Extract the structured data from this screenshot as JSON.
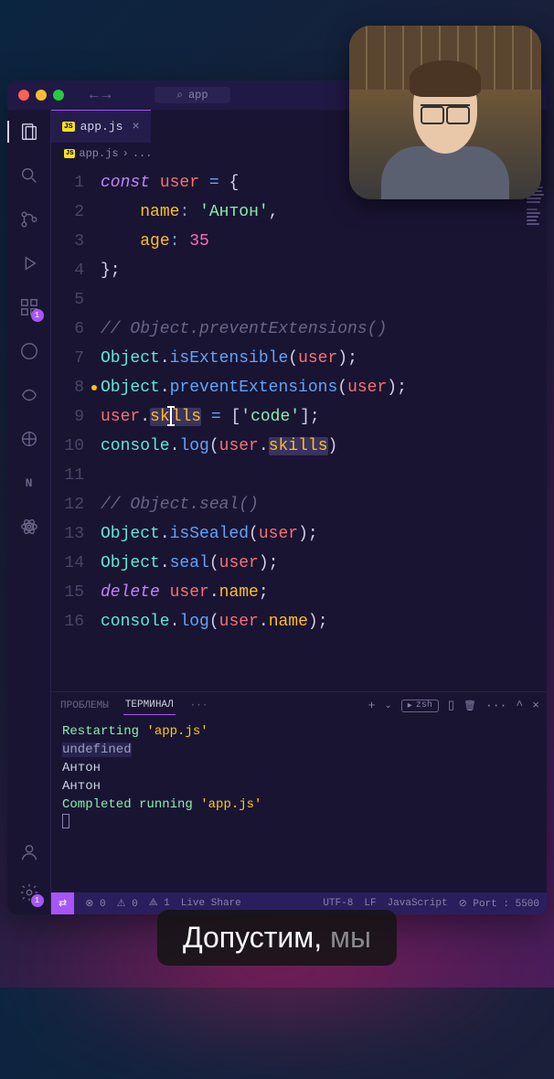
{
  "titlebar": {
    "search_text": "app"
  },
  "tabs": [
    {
      "icon": "JS",
      "label": "app.js"
    }
  ],
  "breadcrumbs": {
    "icon": "JS",
    "path": "app.js",
    "sep": "›",
    "more": "..."
  },
  "code": {
    "lines": [
      1,
      2,
      3,
      4,
      5,
      6,
      7,
      8,
      9,
      10,
      11,
      12,
      13,
      14,
      15,
      16
    ],
    "l1": {
      "kw": "const",
      "var": "user",
      "op": " = ",
      "pn": "{"
    },
    "l2": {
      "prop": "name",
      "op": ":",
      "str": "'Антон'",
      "pn": ","
    },
    "l3": {
      "prop": "age",
      "op": ":",
      "num": "35"
    },
    "l4": {
      "pn": "};"
    },
    "l6": {
      "cm": "// Object.preventExtensions()"
    },
    "l7": {
      "obj": "Object",
      "dot": ".",
      "fn": "isExtensible",
      "p1": "(",
      "arg": "user",
      "p2": ");"
    },
    "l8": {
      "obj": "Object",
      "dot": ".",
      "fn": "preventExtensions",
      "p1": "(",
      "arg": "user",
      "p2": ");"
    },
    "l9": {
      "var": "user",
      "dot": ".",
      "prop1": "sk",
      "prop2": "lls",
      "op": " = ",
      "b1": "[",
      "str": "'code'",
      "b2": "];"
    },
    "l10": {
      "obj": "console",
      "dot": ".",
      "fn": "log",
      "p1": "(",
      "arg1": "user",
      "dot2": ".",
      "arg2": "skills",
      "p2": ")"
    },
    "l12": {
      "cm": "// Object.seal()"
    },
    "l13": {
      "obj": "Object",
      "dot": ".",
      "fn": "isSealed",
      "p1": "(",
      "arg": "user",
      "p2": ");"
    },
    "l14": {
      "obj": "Object",
      "dot": ".",
      "fn": "seal",
      "p1": "(",
      "arg": "user",
      "p2": ");"
    },
    "l15": {
      "kw": "delete",
      "var": "user",
      "dot": ".",
      "prop": "name",
      "pn": ";"
    },
    "l16": {
      "obj": "console",
      "dot": ".",
      "fn": "log",
      "p1": "(",
      "arg1": "user",
      "dot2": ".",
      "arg2": "name",
      "p2": ");"
    }
  },
  "panel": {
    "tabs": {
      "problems": "ПРОБЛЕМЫ",
      "terminal": "ТЕРМИНАЛ",
      "more": "···"
    },
    "actions": {
      "plus": "+",
      "zsh": "zsh",
      "split": "▯",
      "trash": "🗑",
      "more": "···",
      "chevron": "^",
      "close": "×"
    },
    "output": {
      "l1a": "Restarting ",
      "l1b": "'app.js'",
      "l2": "undefined",
      "l3": "Антон",
      "l4": "Антон",
      "l5a": "Completed running ",
      "l5b": "'app.js'"
    }
  },
  "statusbar": {
    "remote": "⇄",
    "errors": "⊗ 0",
    "warnings": "⚠ 0",
    "signal": "⟁ 1",
    "liveshare": "Live Share",
    "encoding": "UTF-8",
    "eol": "LF",
    "lang": "JavaScript",
    "port": "⊘ Port : 5500"
  },
  "activity_badge": "1",
  "caption": {
    "word1": "Допустим,",
    "word2": "мы"
  }
}
